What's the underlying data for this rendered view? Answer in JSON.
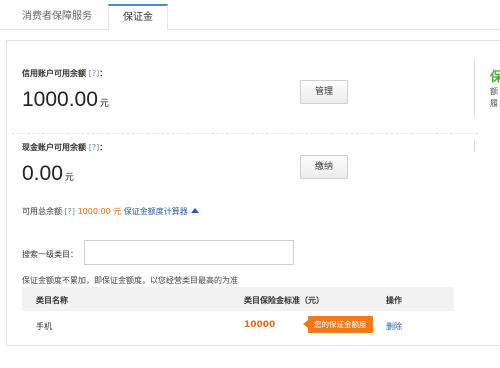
{
  "tabs": [
    {
      "label": "消费者保障服务",
      "active": false
    },
    {
      "label": "保证金",
      "active": true
    }
  ],
  "credit": {
    "title": "信用账户可用余额",
    "hint": "[?]",
    "colon": "：",
    "amount": "1000.00",
    "unit": "元",
    "button": "管理"
  },
  "cash": {
    "title": "现金账户可用余额",
    "hint": "[?]",
    "colon": "：",
    "amount": "0.00",
    "unit": "元",
    "button": "缴纳"
  },
  "side": {
    "icon_char": "保",
    "line1": "额",
    "line2": "履"
  },
  "total": {
    "label": "可用总余额",
    "hint": "[?]",
    "amount": "1000.00 元",
    "calc_link": "保证金额度计算器"
  },
  "search": {
    "label": "搜索一级类目：",
    "value": "",
    "placeholder": ""
  },
  "note": "保证金额度不累加，即保证金额度，以您经营类目最高的为准",
  "table": {
    "headers": [
      "类目名称",
      "类目保险金标准（元）",
      "操作"
    ],
    "rows": [
      {
        "category": "手机",
        "standard": "10000",
        "badge": "您的保证金额度",
        "action": "删除"
      }
    ]
  },
  "colors": {
    "accent_blue": "#2a5ea8",
    "orange": "#e06a1a",
    "badge_orange": "#f07a1a",
    "green": "#49b33c"
  }
}
